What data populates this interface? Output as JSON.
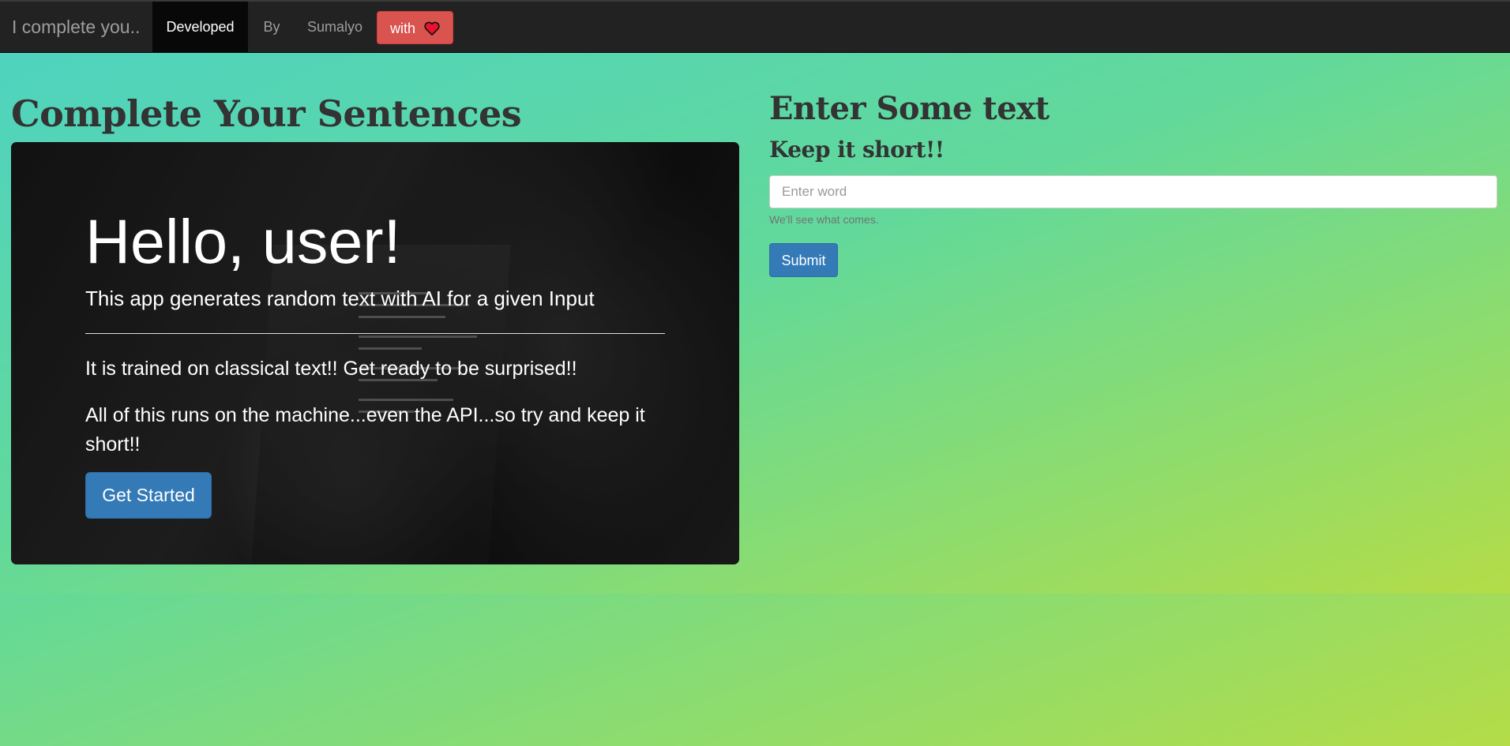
{
  "navbar": {
    "brand": "I complete you..",
    "items": [
      {
        "label": "Developed",
        "active": true
      },
      {
        "label": "By",
        "active": false
      },
      {
        "label": "Sumalyo",
        "active": false
      }
    ],
    "with_button": {
      "label": "with",
      "icon": "heart-icon"
    }
  },
  "left": {
    "heading": "Complete Your Sentences",
    "jumbotron": {
      "title": "Hello, user!",
      "lead": "This app generates random text with AI for a given Input",
      "paragraph1": "It is trained on classical text!! Get ready to be surprised!!",
      "paragraph2": "All of this runs on the machine...even the API...so try and keep it short!!",
      "button": "Get Started"
    }
  },
  "right": {
    "heading": "Enter Some text",
    "subheading": "Keep it short!!",
    "input": {
      "placeholder": "Enter word",
      "value": ""
    },
    "help_text": "We'll see what comes.",
    "submit": "Submit"
  },
  "colors": {
    "navbar_bg": "#222222",
    "primary": "#337ab7",
    "danger": "#d9534f",
    "gradient_start": "#4fd3bf",
    "gradient_end": "#b4dc48"
  }
}
